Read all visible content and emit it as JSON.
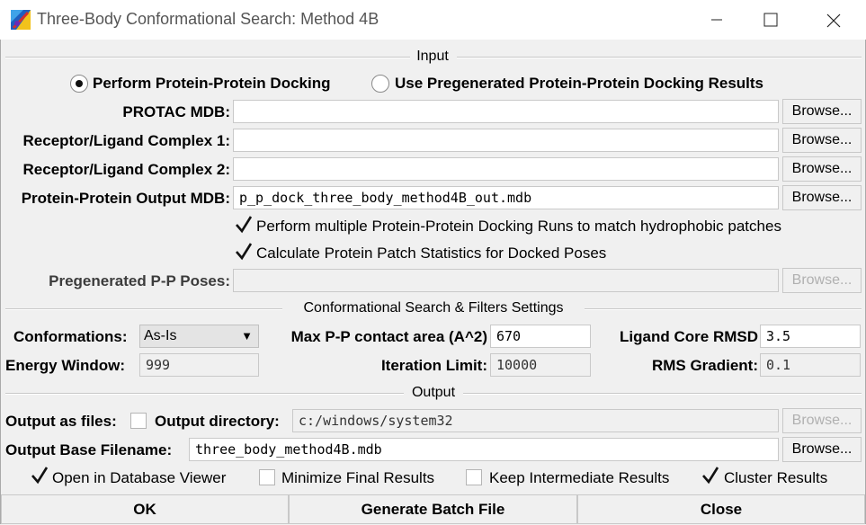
{
  "window": {
    "title": "Three-Body Conformational Search: Method 4B",
    "icons": [
      "app-icon",
      "minimize-icon",
      "maximize-icon",
      "close-icon"
    ]
  },
  "input": {
    "section_title": "Input",
    "mode_options": [
      {
        "label": "Perform Protein-Protein Docking",
        "selected": true
      },
      {
        "label": "Use Pregenerated Protein-Protein Docking Results",
        "selected": false
      }
    ],
    "protac_label": "PROTAC MDB:",
    "protac_value": "",
    "complex1_label": "Receptor/Ligand Complex 1:",
    "complex1_value": "",
    "complex2_label": "Receptor/Ligand Complex 2:",
    "complex2_value": "",
    "pp_output_label": "Protein-Protein Output MDB:",
    "pp_output_value": "p_p_dock_three_body_method4B_out.mdb",
    "multi_runs_label": "Perform multiple Protein-Protein Docking Runs to match hydrophobic patches",
    "multi_runs_checked": true,
    "patch_stats_label": "Calculate Protein Patch Statistics for Docked Poses",
    "patch_stats_checked": true,
    "pregen_label": "Pregenerated P-P Poses:",
    "pregen_value": "",
    "browse_label": "Browse..."
  },
  "settings": {
    "section_title": "Conformational Search & Filters Settings",
    "conformations_label": "Conformations:",
    "conformations_value": "As-Is",
    "max_contact_label": "Max P-P contact area (A^2)",
    "max_contact_value": "670",
    "ligand_rmsd_label": "Ligand Core RMSD",
    "ligand_rmsd_value": "3.5",
    "energy_window_label": "Energy Window:",
    "energy_window_value": "999",
    "iteration_limit_label": "Iteration Limit:",
    "iteration_limit_value": "10000",
    "rms_gradient_label": "RMS Gradient:",
    "rms_gradient_value": "0.1"
  },
  "output": {
    "section_title": "Output",
    "as_files_label": "Output as files:",
    "as_files_checked": false,
    "directory_label": "Output directory:",
    "directory_value": "c:/windows/system32",
    "base_filename_label": "Output Base Filename:",
    "base_filename_value": "three_body_method4B.mdb",
    "options": [
      {
        "label": "Open in Database Viewer",
        "checked": true
      },
      {
        "label": "Minimize Final Results",
        "checked": false
      },
      {
        "label": "Keep Intermediate Results",
        "checked": false
      },
      {
        "label": "Cluster Results",
        "checked": true
      }
    ]
  },
  "buttons": {
    "ok": "OK",
    "batch": "Generate Batch File",
    "close": "Close"
  }
}
